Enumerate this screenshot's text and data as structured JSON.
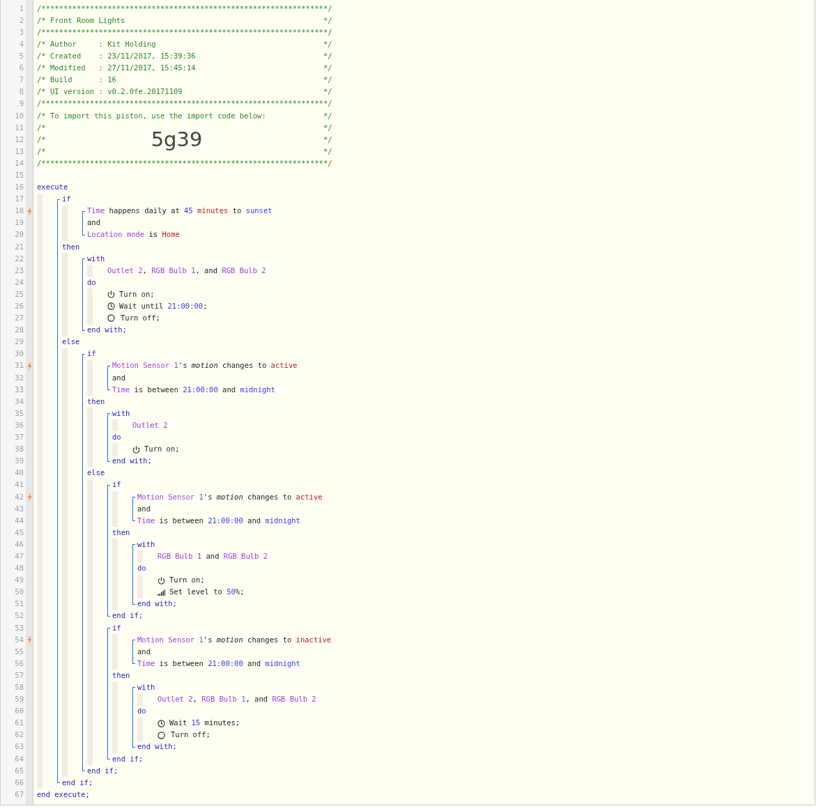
{
  "gutter": [
    {
      "number": "1",
      "trigger": false
    },
    {
      "number": "2",
      "trigger": false
    },
    {
      "number": "3",
      "trigger": false
    },
    {
      "number": "4",
      "trigger": false
    },
    {
      "number": "5",
      "trigger": false
    },
    {
      "number": "6",
      "trigger": false
    },
    {
      "number": "7",
      "trigger": false
    },
    {
      "number": "8",
      "trigger": false
    },
    {
      "number": "9",
      "trigger": false
    },
    {
      "number": "10",
      "trigger": false
    },
    {
      "number": "11",
      "trigger": false
    },
    {
      "number": "12",
      "trigger": false
    },
    {
      "number": "13",
      "trigger": false
    },
    {
      "number": "14",
      "trigger": false
    },
    {
      "number": "15",
      "trigger": false
    },
    {
      "number": "16",
      "trigger": false
    },
    {
      "number": "17",
      "trigger": false
    },
    {
      "number": "18",
      "trigger": true
    },
    {
      "number": "19",
      "trigger": false
    },
    {
      "number": "20",
      "trigger": false
    },
    {
      "number": "21",
      "trigger": false
    },
    {
      "number": "22",
      "trigger": false
    },
    {
      "number": "23",
      "trigger": false
    },
    {
      "number": "24",
      "trigger": false
    },
    {
      "number": "25",
      "trigger": false
    },
    {
      "number": "26",
      "trigger": false
    },
    {
      "number": "27",
      "trigger": false
    },
    {
      "number": "28",
      "trigger": false
    },
    {
      "number": "29",
      "trigger": false
    },
    {
      "number": "30",
      "trigger": false
    },
    {
      "number": "31",
      "trigger": true
    },
    {
      "number": "32",
      "trigger": false
    },
    {
      "number": "33",
      "trigger": false
    },
    {
      "number": "34",
      "trigger": false
    },
    {
      "number": "35",
      "trigger": false
    },
    {
      "number": "36",
      "trigger": false
    },
    {
      "number": "37",
      "trigger": false
    },
    {
      "number": "38",
      "trigger": false
    },
    {
      "number": "39",
      "trigger": false
    },
    {
      "number": "40",
      "trigger": false
    },
    {
      "number": "41",
      "trigger": false
    },
    {
      "number": "42",
      "trigger": true
    },
    {
      "number": "43",
      "trigger": false
    },
    {
      "number": "44",
      "trigger": false
    },
    {
      "number": "45",
      "trigger": false
    },
    {
      "number": "46",
      "trigger": false
    },
    {
      "number": "47",
      "trigger": false
    },
    {
      "number": "48",
      "trigger": false
    },
    {
      "number": "49",
      "trigger": false
    },
    {
      "number": "50",
      "trigger": false
    },
    {
      "number": "51",
      "trigger": false
    },
    {
      "number": "52",
      "trigger": false
    },
    {
      "number": "53",
      "trigger": false
    },
    {
      "number": "54",
      "trigger": true
    },
    {
      "number": "55",
      "trigger": false
    },
    {
      "number": "56",
      "trigger": false
    },
    {
      "number": "57",
      "trigger": false
    },
    {
      "number": "58",
      "trigger": false
    },
    {
      "number": "59",
      "trigger": false
    },
    {
      "number": "60",
      "trigger": false
    },
    {
      "number": "61",
      "trigger": false
    },
    {
      "number": "62",
      "trigger": false
    },
    {
      "number": "63",
      "trigger": false
    },
    {
      "number": "64",
      "trigger": false
    },
    {
      "number": "65",
      "trigger": false
    },
    {
      "number": "66",
      "trigger": false
    },
    {
      "number": "67",
      "trigger": false
    }
  ],
  "header": [
    {
      "kind": "rule",
      "text": "/*****************************************************************/"
    },
    {
      "kind": "text",
      "left": "/* Front Room Lights",
      "right": "*/"
    },
    {
      "kind": "rule",
      "text": "/*****************************************************************/"
    },
    {
      "kind": "text",
      "left": "/* Author     : Kit Holding",
      "right": "*/"
    },
    {
      "kind": "text",
      "left": "/* Created    : 23/11/2017, 15:39:36",
      "right": "*/"
    },
    {
      "kind": "text",
      "left": "/* Modified   : 27/11/2017, 15:45:14",
      "right": "*/"
    },
    {
      "kind": "text",
      "left": "/* Build      : 16",
      "right": "*/"
    },
    {
      "kind": "text",
      "left": "/* UI version : v0.2.0fe.20171109",
      "right": "*/"
    },
    {
      "kind": "rule",
      "text": "/*****************************************************************/"
    },
    {
      "kind": "text",
      "left": "/* To import this piston, use the import code below:",
      "right": "*/"
    },
    {
      "kind": "text",
      "left": "/*",
      "right": "*/"
    },
    {
      "kind": "code",
      "left": "/*",
      "code": "5g39",
      "right": "*/"
    },
    {
      "kind": "text",
      "left": "/*",
      "right": "*/"
    },
    {
      "kind": "rule",
      "text": "/*****************************************************************/"
    },
    {
      "kind": "blank"
    }
  ],
  "program": {
    "bracket": false,
    "items": [
      {
        "tokens": [
          {
            "text": "execute",
            "kind": "keyword"
          }
        ],
        "body": [
          {
            "bracket": true,
            "items": [
              {
                "tokens": [
                  {
                    "text": "if",
                    "kind": "keyword"
                  }
                ],
                "body": [
                  {
                    "bracket": true,
                    "items": [
                      {
                        "tokens": [
                          {
                            "text": "Time",
                            "kind": "device"
                          },
                          {
                            "text": " happens daily at ",
                            "kind": "text"
                          },
                          {
                            "text": "45",
                            "kind": "value"
                          },
                          {
                            "text": " minutes",
                            "kind": "constant"
                          },
                          {
                            "text": " to ",
                            "kind": "text"
                          },
                          {
                            "text": "sunset",
                            "kind": "value"
                          }
                        ]
                      },
                      {
                        "tokens": [
                          {
                            "text": "and",
                            "kind": "text"
                          }
                        ]
                      },
                      {
                        "tokens": [
                          {
                            "text": "Location mode",
                            "kind": "device"
                          },
                          {
                            "text": " is ",
                            "kind": "text"
                          },
                          {
                            "text": "Home",
                            "kind": "constant"
                          }
                        ]
                      }
                    ]
                  }
                ]
              },
              {
                "tokens": [
                  {
                    "text": "then",
                    "kind": "keyword"
                  }
                ],
                "body": [
                  {
                    "bracket": true,
                    "items": [
                      {
                        "tokens": [
                          {
                            "text": "with",
                            "kind": "keyword"
                          }
                        ],
                        "body": [
                          {
                            "tokens": [
                              {
                                "text": "Outlet 2",
                                "kind": "device"
                              },
                              {
                                "text": ", ",
                                "kind": "text"
                              },
                              {
                                "text": "RGB Bulb 1",
                                "kind": "device"
                              },
                              {
                                "text": ", and ",
                                "kind": "text"
                              },
                              {
                                "text": "RGB Bulb 2",
                                "kind": "device"
                              }
                            ]
                          }
                        ]
                      },
                      {
                        "tokens": [
                          {
                            "text": "do",
                            "kind": "keyword"
                          }
                        ],
                        "body": [
                          {
                            "kind": "on",
                            "tokens": [
                              {
                                "text": "Turn on;",
                                "kind": "text"
                              }
                            ]
                          },
                          {
                            "kind": "wait",
                            "tokens": [
                              {
                                "text": "Wait until ",
                                "kind": "text"
                              },
                              {
                                "text": "21:00:00",
                                "kind": "value"
                              },
                              {
                                "text": ";",
                                "kind": "text"
                              }
                            ]
                          },
                          {
                            "kind": "off",
                            "tokens": [
                              {
                                "text": "Turn off;",
                                "kind": "text"
                              }
                            ]
                          }
                        ]
                      },
                      {
                        "tokens": [
                          {
                            "text": "end with;",
                            "kind": "keyword"
                          }
                        ]
                      }
                    ]
                  }
                ]
              },
              {
                "tokens": [
                  {
                    "text": "else",
                    "kind": "keyword"
                  }
                ],
                "body": [
                  {
                    "bracket": true,
                    "items": [
                      {
                        "tokens": [
                          {
                            "text": "if",
                            "kind": "keyword"
                          }
                        ],
                        "body": [
                          {
                            "bracket": true,
                            "items": [
                              {
                                "tokens": [
                                  {
                                    "text": "Motion Sensor 1",
                                    "kind": "device"
                                  },
                                  {
                                    "text": "'s ",
                                    "kind": "text"
                                  },
                                  {
                                    "text": "motion",
                                    "kind": "attribute"
                                  },
                                  {
                                    "text": " changes to ",
                                    "kind": "text"
                                  },
                                  {
                                    "text": "active",
                                    "kind": "constant"
                                  }
                                ]
                              },
                              {
                                "tokens": [
                                  {
                                    "text": "and",
                                    "kind": "text"
                                  }
                                ]
                              },
                              {
                                "tokens": [
                                  {
                                    "text": "Time",
                                    "kind": "device"
                                  },
                                  {
                                    "text": " is between ",
                                    "kind": "text"
                                  },
                                  {
                                    "text": "21:00:00",
                                    "kind": "value"
                                  },
                                  {
                                    "text": " and ",
                                    "kind": "text"
                                  },
                                  {
                                    "text": "midnight",
                                    "kind": "value"
                                  }
                                ]
                              }
                            ]
                          }
                        ]
                      },
                      {
                        "tokens": [
                          {
                            "text": "then",
                            "kind": "keyword"
                          }
                        ],
                        "body": [
                          {
                            "bracket": true,
                            "items": [
                              {
                                "tokens": [
                                  {
                                    "text": "with",
                                    "kind": "keyword"
                                  }
                                ],
                                "body": [
                                  {
                                    "tokens": [
                                      {
                                        "text": "Outlet 2",
                                        "kind": "device"
                                      }
                                    ]
                                  }
                                ]
                              },
                              {
                                "tokens": [
                                  {
                                    "text": "do",
                                    "kind": "keyword"
                                  }
                                ],
                                "body": [
                                  {
                                    "kind": "on",
                                    "tokens": [
                                      {
                                        "text": "Turn on;",
                                        "kind": "text"
                                      }
                                    ]
                                  }
                                ]
                              },
                              {
                                "tokens": [
                                  {
                                    "text": "end with;",
                                    "kind": "keyword"
                                  }
                                ]
                              }
                            ]
                          }
                        ]
                      },
                      {
                        "tokens": [
                          {
                            "text": "else",
                            "kind": "keyword"
                          }
                        ],
                        "body": [
                          {
                            "bracket": true,
                            "items": [
                              {
                                "tokens": [
                                  {
                                    "text": "if",
                                    "kind": "keyword"
                                  }
                                ],
                                "body": [
                                  {
                                    "bracket": true,
                                    "items": [
                                      {
                                        "tokens": [
                                          {
                                            "text": "Motion Sensor 1",
                                            "kind": "device"
                                          },
                                          {
                                            "text": "'s ",
                                            "kind": "text"
                                          },
                                          {
                                            "text": "motion",
                                            "kind": "attribute"
                                          },
                                          {
                                            "text": " changes to ",
                                            "kind": "text"
                                          },
                                          {
                                            "text": "active",
                                            "kind": "constant"
                                          }
                                        ]
                                      },
                                      {
                                        "tokens": [
                                          {
                                            "text": "and",
                                            "kind": "text"
                                          }
                                        ]
                                      },
                                      {
                                        "tokens": [
                                          {
                                            "text": "Time",
                                            "kind": "device"
                                          },
                                          {
                                            "text": " is between ",
                                            "kind": "text"
                                          },
                                          {
                                            "text": "21:00:00",
                                            "kind": "value"
                                          },
                                          {
                                            "text": " and ",
                                            "kind": "text"
                                          },
                                          {
                                            "text": "midnight",
                                            "kind": "value"
                                          }
                                        ]
                                      }
                                    ]
                                  }
                                ]
                              },
                              {
                                "tokens": [
                                  {
                                    "text": "then",
                                    "kind": "keyword"
                                  }
                                ],
                                "body": [
                                  {
                                    "bracket": true,
                                    "items": [
                                      {
                                        "tokens": [
                                          {
                                            "text": "with",
                                            "kind": "keyword"
                                          }
                                        ],
                                        "body": [
                                          {
                                            "tokens": [
                                              {
                                                "text": "RGB Bulb 1",
                                                "kind": "device"
                                              },
                                              {
                                                "text": " and ",
                                                "kind": "text"
                                              },
                                              {
                                                "text": "RGB Bulb 2",
                                                "kind": "device"
                                              }
                                            ]
                                          }
                                        ]
                                      },
                                      {
                                        "tokens": [
                                          {
                                            "text": "do",
                                            "kind": "keyword"
                                          }
                                        ],
                                        "body": [
                                          {
                                            "kind": "on",
                                            "tokens": [
                                              {
                                                "text": "Turn on;",
                                                "kind": "text"
                                              }
                                            ]
                                          },
                                          {
                                            "kind": "level",
                                            "tokens": [
                                              {
                                                "text": "Set level to ",
                                                "kind": "text"
                                              },
                                              {
                                                "text": "50",
                                                "kind": "value"
                                              },
                                              {
                                                "text": "%;",
                                                "kind": "text"
                                              }
                                            ]
                                          }
                                        ]
                                      },
                                      {
                                        "tokens": [
                                          {
                                            "text": "end with;",
                                            "kind": "keyword"
                                          }
                                        ]
                                      }
                                    ]
                                  }
                                ]
                              },
                              {
                                "tokens": [
                                  {
                                    "text": "end if;",
                                    "kind": "keyword"
                                  }
                                ]
                              }
                            ]
                          },
                          {
                            "bracket": true,
                            "items": [
                              {
                                "tokens": [
                                  {
                                    "text": "if",
                                    "kind": "keyword"
                                  }
                                ],
                                "body": [
                                  {
                                    "bracket": true,
                                    "items": [
                                      {
                                        "tokens": [
                                          {
                                            "text": "Motion Sensor 1",
                                            "kind": "device"
                                          },
                                          {
                                            "text": "'s ",
                                            "kind": "text"
                                          },
                                          {
                                            "text": "motion",
                                            "kind": "attribute"
                                          },
                                          {
                                            "text": " changes to ",
                                            "kind": "text"
                                          },
                                          {
                                            "text": "inactive",
                                            "kind": "constant"
                                          }
                                        ]
                                      },
                                      {
                                        "tokens": [
                                          {
                                            "text": "and",
                                            "kind": "text"
                                          }
                                        ]
                                      },
                                      {
                                        "tokens": [
                                          {
                                            "text": "Time",
                                            "kind": "device"
                                          },
                                          {
                                            "text": " is between ",
                                            "kind": "text"
                                          },
                                          {
                                            "text": "21:00:00",
                                            "kind": "value"
                                          },
                                          {
                                            "text": " and ",
                                            "kind": "text"
                                          },
                                          {
                                            "text": "midnight",
                                            "kind": "value"
                                          }
                                        ]
                                      }
                                    ]
                                  }
                                ]
                              },
                              {
                                "tokens": [
                                  {
                                    "text": "then",
                                    "kind": "keyword"
                                  }
                                ],
                                "body": [
                                  {
                                    "bracket": true,
                                    "items": [
                                      {
                                        "tokens": [
                                          {
                                            "text": "with",
                                            "kind": "keyword"
                                          }
                                        ],
                                        "body": [
                                          {
                                            "tokens": [
                                              {
                                                "text": "Outlet 2",
                                                "kind": "device"
                                              },
                                              {
                                                "text": ", ",
                                                "kind": "text"
                                              },
                                              {
                                                "text": "RGB Bulb 1",
                                                "kind": "device"
                                              },
                                              {
                                                "text": ", and ",
                                                "kind": "text"
                                              },
                                              {
                                                "text": "RGB Bulb 2",
                                                "kind": "device"
                                              }
                                            ]
                                          }
                                        ]
                                      },
                                      {
                                        "tokens": [
                                          {
                                            "text": "do",
                                            "kind": "keyword"
                                          }
                                        ],
                                        "body": [
                                          {
                                            "kind": "wait",
                                            "tokens": [
                                              {
                                                "text": "Wait ",
                                                "kind": "text"
                                              },
                                              {
                                                "text": "15",
                                                "kind": "value"
                                              },
                                              {
                                                "text": " minutes;",
                                                "kind": "text"
                                              }
                                            ]
                                          },
                                          {
                                            "kind": "off",
                                            "tokens": [
                                              {
                                                "text": "Turn off;",
                                                "kind": "text"
                                              }
                                            ]
                                          }
                                        ]
                                      },
                                      {
                                        "tokens": [
                                          {
                                            "text": "end with;",
                                            "kind": "keyword"
                                          }
                                        ]
                                      }
                                    ]
                                  }
                                ]
                              },
                              {
                                "tokens": [
                                  {
                                    "text": "end if;",
                                    "kind": "keyword"
                                  }
                                ]
                              }
                            ]
                          }
                        ]
                      },
                      {
                        "tokens": [
                          {
                            "text": "end if;",
                            "kind": "keyword"
                          }
                        ]
                      }
                    ]
                  }
                ]
              },
              {
                "tokens": [
                  {
                    "text": "end if;",
                    "kind": "keyword"
                  }
                ]
              }
            ]
          }
        ]
      },
      {
        "tokens": [
          {
            "text": "end execute;",
            "kind": "keyword"
          }
        ]
      }
    ]
  }
}
